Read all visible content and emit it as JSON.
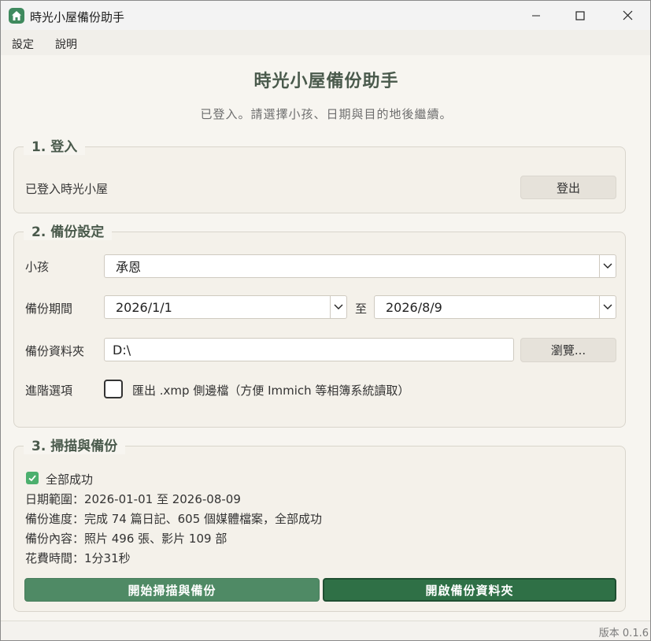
{
  "window": {
    "title": "時光小屋備份助手",
    "icon": "home-icon",
    "accent_color": "#3f8a5f"
  },
  "menu": {
    "settings": "設定",
    "help": "說明"
  },
  "header": {
    "title": "時光小屋備份助手",
    "subtitle": "已登入。請選擇小孩、日期與目的地後繼續。"
  },
  "login": {
    "section_title": "1. 登入",
    "status": "已登入時光小屋",
    "logout_label": "登出"
  },
  "settings": {
    "section_title": "2. 備份設定",
    "child_label": "小孩",
    "child_value": "承恩",
    "period_label": "備份期間",
    "start_date": "2026/1/1",
    "to_label": "至",
    "end_date": "2026/8/9",
    "folder_label": "備份資料夾",
    "folder_value": "D:\\",
    "browse_label": "瀏覽...",
    "advanced_label": "進階選項",
    "xmp_option": "匯出 .xmp 側邊檔（方便 Immich 等相簿系統讀取）",
    "xmp_checked": false
  },
  "scan": {
    "section_title": "3. 掃描與備份",
    "result": "全部成功",
    "date_range": "日期範圍：2026-01-01 至 2026-08-09",
    "progress": "備份進度：完成 74 篇日記、605 個媒體檔案，全部成功",
    "content": "備份內容：照片 496 張、影片 109 部",
    "elapsed": "花費時間：1分31秒",
    "start_label": "開始掃描與備份",
    "open_label": "開啟備份資料夾",
    "success_color": "#4caf6e"
  },
  "statusbar": {
    "version": "版本 0.1.6"
  }
}
